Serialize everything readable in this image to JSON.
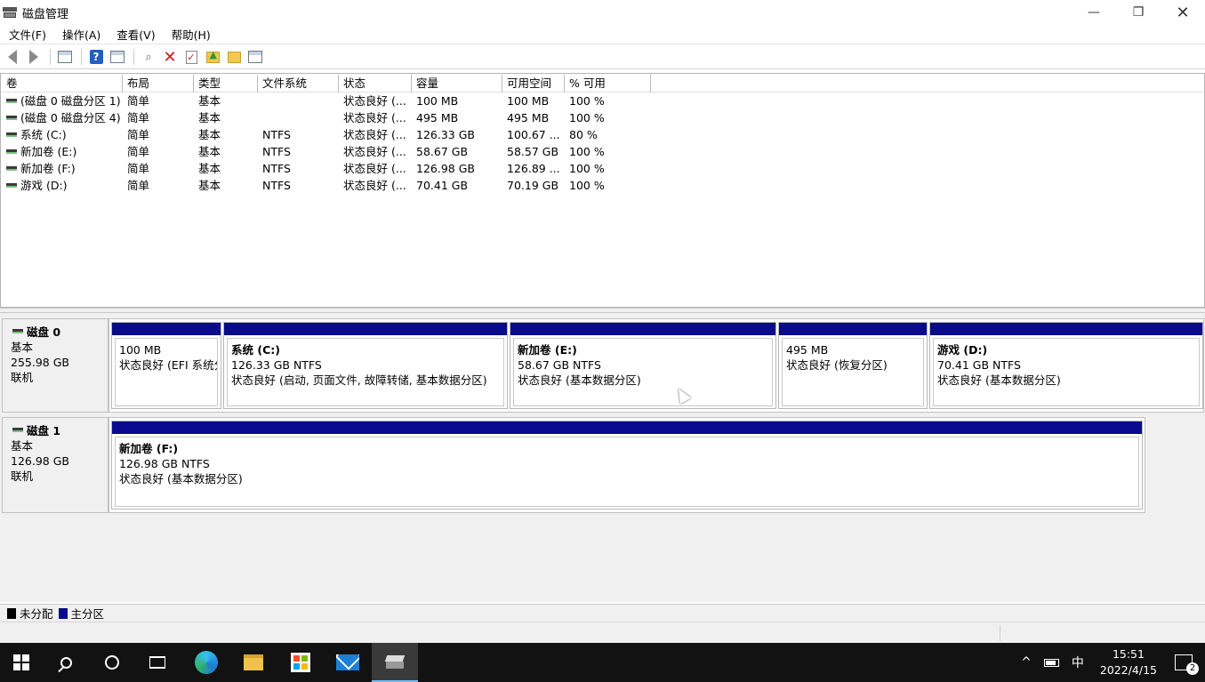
{
  "window": {
    "title": "磁盘管理",
    "minimize": "—",
    "maximize": "❐",
    "close": "✕"
  },
  "menu": [
    "文件(F)",
    "操作(A)",
    "查看(V)",
    "帮助(H)"
  ],
  "toolbar": {
    "help_label": "?"
  },
  "volume_table": {
    "columns": [
      "卷",
      "布局",
      "类型",
      "文件系统",
      "状态",
      "容量",
      "可用空间",
      "% 可用"
    ],
    "rows": [
      {
        "volume": "(磁盘 0 磁盘分区 1)",
        "layout": "简单",
        "type": "基本",
        "fs": "",
        "status": "状态良好 (...",
        "capacity": "100 MB",
        "free": "100 MB",
        "pct": "100 %"
      },
      {
        "volume": "(磁盘 0 磁盘分区 4)",
        "layout": "简单",
        "type": "基本",
        "fs": "",
        "status": "状态良好 (...",
        "capacity": "495 MB",
        "free": "495 MB",
        "pct": "100 %"
      },
      {
        "volume": "系统 (C:)",
        "layout": "简单",
        "type": "基本",
        "fs": "NTFS",
        "status": "状态良好 (...",
        "capacity": "126.33 GB",
        "free": "100.67 ...",
        "pct": "80 %"
      },
      {
        "volume": "新加卷 (E:)",
        "layout": "简单",
        "type": "基本",
        "fs": "NTFS",
        "status": "状态良好 (...",
        "capacity": "58.67 GB",
        "free": "58.57 GB",
        "pct": "100 %"
      },
      {
        "volume": "新加卷 (F:)",
        "layout": "简单",
        "type": "基本",
        "fs": "NTFS",
        "status": "状态良好 (...",
        "capacity": "126.98 GB",
        "free": "126.89 ...",
        "pct": "100 %"
      },
      {
        "volume": "游戏 (D:)",
        "layout": "简单",
        "type": "基本",
        "fs": "NTFS",
        "status": "状态良好 (...",
        "capacity": "70.41 GB",
        "free": "70.19 GB",
        "pct": "100 %"
      }
    ]
  },
  "disks": [
    {
      "name": "磁盘 0",
      "kind": "基本",
      "size": "255.98 GB",
      "state": "联机",
      "partitions": [
        {
          "name": "",
          "size": "100 MB",
          "status": "状态良好 (EFI 系统分"
        },
        {
          "name": "系统 (C:)",
          "size": "126.33 GB NTFS",
          "status": "状态良好 (启动, 页面文件, 故障转储, 基本数据分区)"
        },
        {
          "name": "新加卷 (E:)",
          "size": "58.67 GB NTFS",
          "status": "状态良好 (基本数据分区)"
        },
        {
          "name": "",
          "size": "495 MB",
          "status": "状态良好 (恢复分区)"
        },
        {
          "name": "游戏 (D:)",
          "size": "70.41 GB NTFS",
          "status": "状态良好 (基本数据分区)"
        }
      ]
    },
    {
      "name": "磁盘 1",
      "kind": "基本",
      "size": "126.98 GB",
      "state": "联机",
      "partitions": [
        {
          "name": "新加卷 (F:)",
          "size": "126.98 GB NTFS",
          "status": "状态良好 (基本数据分区)"
        }
      ]
    }
  ],
  "legend": {
    "unallocated": "未分配",
    "primary": "主分区"
  },
  "colors": {
    "primary_partition": "#0a0a8e",
    "unallocated": "#000000"
  },
  "taskbar": {
    "ime": "中",
    "time": "15:51",
    "date": "2022/4/15",
    "notifications": "2",
    "chevron": "^"
  }
}
